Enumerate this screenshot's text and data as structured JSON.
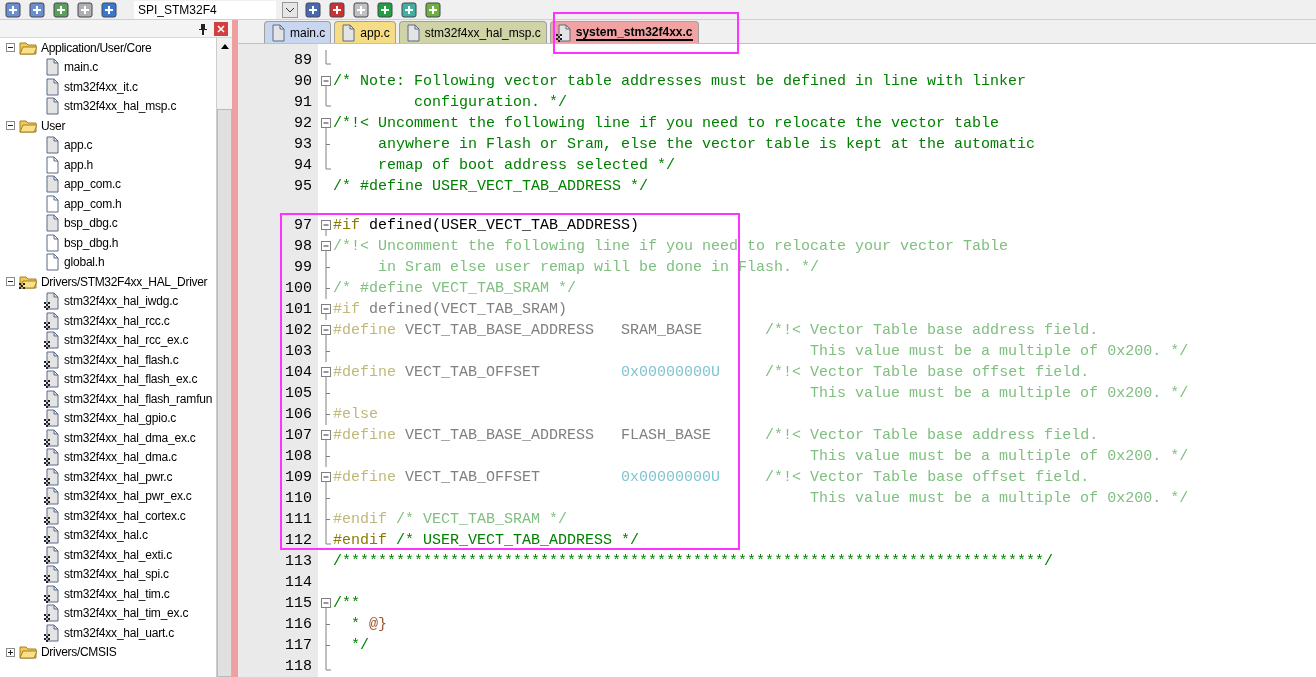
{
  "toolbar": {
    "target": "SPI_STM32F4"
  },
  "project": {
    "items": [
      {
        "label": "Application/User/Core",
        "kind": "folder",
        "expanded": true,
        "children": [
          {
            "label": "main.c",
            "kind": "source"
          },
          {
            "label": "stm32f4xx_it.c",
            "kind": "source"
          },
          {
            "label": "stm32f4xx_hal_msp.c",
            "kind": "source"
          }
        ]
      },
      {
        "label": "User",
        "kind": "folder",
        "expanded": true,
        "children": [
          {
            "label": "app.c",
            "kind": "source"
          },
          {
            "label": "app.h",
            "kind": "header"
          },
          {
            "label": "app_com.c",
            "kind": "source"
          },
          {
            "label": "app_com.h",
            "kind": "header"
          },
          {
            "label": "bsp_dbg.c",
            "kind": "source"
          },
          {
            "label": "bsp_dbg.h",
            "kind": "header"
          },
          {
            "label": "global.h",
            "kind": "header"
          }
        ]
      },
      {
        "label": "Drivers/STM32F4xx_HAL_Driver",
        "kind": "library",
        "expanded": true,
        "children": [
          {
            "label": "stm32f4xx_hal_iwdg.c",
            "kind": "library"
          },
          {
            "label": "stm32f4xx_hal_rcc.c",
            "kind": "library"
          },
          {
            "label": "stm32f4xx_hal_rcc_ex.c",
            "kind": "library"
          },
          {
            "label": "stm32f4xx_hal_flash.c",
            "kind": "library"
          },
          {
            "label": "stm32f4xx_hal_flash_ex.c",
            "kind": "library"
          },
          {
            "label": "stm32f4xx_hal_flash_ramfun",
            "kind": "library"
          },
          {
            "label": "stm32f4xx_hal_gpio.c",
            "kind": "library"
          },
          {
            "label": "stm32f4xx_hal_dma_ex.c",
            "kind": "library"
          },
          {
            "label": "stm32f4xx_hal_dma.c",
            "kind": "library"
          },
          {
            "label": "stm32f4xx_hal_pwr.c",
            "kind": "library"
          },
          {
            "label": "stm32f4xx_hal_pwr_ex.c",
            "kind": "library"
          },
          {
            "label": "stm32f4xx_hal_cortex.c",
            "kind": "library"
          },
          {
            "label": "stm32f4xx_hal.c",
            "kind": "library"
          },
          {
            "label": "stm32f4xx_hal_exti.c",
            "kind": "library"
          },
          {
            "label": "stm32f4xx_hal_spi.c",
            "kind": "library"
          },
          {
            "label": "stm32f4xx_hal_tim.c",
            "kind": "library"
          },
          {
            "label": "stm32f4xx_hal_tim_ex.c",
            "kind": "library"
          },
          {
            "label": "stm32f4xx_hal_uart.c",
            "kind": "library"
          }
        ]
      },
      {
        "label": "Drivers/CMSIS",
        "kind": "folder",
        "expanded": false
      }
    ]
  },
  "tabs": [
    {
      "label": "main.c",
      "kind": "source",
      "color": "#c9d6ef",
      "selected": false
    },
    {
      "label": "app.c",
      "kind": "source",
      "color": "#f6dd85",
      "selected": false
    },
    {
      "label": "stm32f4xx_hal_msp.c",
      "kind": "source",
      "color": "#cfd3a6",
      "selected": false
    },
    {
      "label": "system_stm32f4xx.c",
      "kind": "library",
      "color": "#f1a3a3",
      "selected": true
    }
  ],
  "editor": {
    "lines": [
      {
        "number": "89",
        "kind": "fold_close"
      },
      {
        "number": "90",
        "kind": "fold_open",
        "tokens": [
          {
            "kind": "comment",
            "text": "/* Note: Following vector table addresses must be defined in line with linker"
          }
        ]
      },
      {
        "number": "91",
        "kind": "fold_close",
        "tokens": [
          {
            "kind": "comment",
            "text": "         configuration. */"
          }
        ]
      },
      {
        "number": "92",
        "kind": "fold_open",
        "tokens": [
          {
            "kind": "comment",
            "text": "/*!< Uncomment the following line if you need to relocate the vector table"
          }
        ]
      },
      {
        "number": "93",
        "kind": "fold_inner",
        "tokens": [
          {
            "kind": "comment",
            "text": "     anywhere in Flash or Sram, else the vector table is kept at the automatic"
          }
        ]
      },
      {
        "number": "94",
        "kind": "fold_close",
        "tokens": [
          {
            "kind": "comment",
            "text": "     remap of boot address selected */"
          }
        ]
      },
      {
        "number": "95",
        "kind": "plain",
        "tokens": [
          {
            "kind": "comment",
            "text": "/* #define USER_VECT_TAB_ADDRESS */"
          }
        ]
      },
      {
        "kind": "plain"
      },
      {
        "number": "97",
        "kind": "fold_open",
        "tokens": [
          {
            "kind": "directive",
            "text": "#if"
          },
          {
            "kind": "plain",
            "text": " defined(USER_VECT_TAB_ADDRESS)"
          }
        ]
      },
      {
        "number": "98",
        "kind": "fold_open",
        "tokens": [
          {
            "kind": "comment_dim",
            "text": "/*!< Uncomment the following line if you need to relocate your vector Table"
          }
        ]
      },
      {
        "number": "99",
        "kind": "fold_inner",
        "tokens": [
          {
            "kind": "comment_dim",
            "text": "     in Sram else user remap will be done in Flash. */"
          }
        ]
      },
      {
        "number": "100",
        "kind": "fold_inner",
        "tokens": [
          {
            "kind": "comment_dim",
            "text": "/* #define VECT_TAB_SRAM */"
          }
        ]
      },
      {
        "number": "101",
        "kind": "fold_open",
        "tokens": [
          {
            "kind": "directive_dim",
            "text": "#if"
          },
          {
            "kind": "plain_dim",
            "text": " defined(VECT_TAB_SRAM)"
          }
        ]
      },
      {
        "number": "102",
        "kind": "fold_open",
        "tokens": [
          {
            "kind": "directive_dim",
            "text": "#define"
          },
          {
            "kind": "plain_dim",
            "text": " VECT_TAB_BASE_ADDRESS   SRAM_BASE       "
          },
          {
            "kind": "comment_dim",
            "text": "/*!< Vector Table base address field."
          }
        ]
      },
      {
        "number": "103",
        "kind": "fold_inner",
        "tokens": [
          {
            "kind": "comment_dim",
            "text": "                                                     This value must be a multiple of 0x200. */"
          }
        ]
      },
      {
        "number": "104",
        "kind": "fold_open",
        "tokens": [
          {
            "kind": "directive_dim",
            "text": "#define"
          },
          {
            "kind": "plain_dim",
            "text": " VECT_TAB_OFFSET         "
          },
          {
            "kind": "number_dim",
            "text": "0x00000000U"
          },
          {
            "kind": "comment_dim",
            "text": "     /*!< Vector Table base offset field."
          }
        ]
      },
      {
        "number": "105",
        "kind": "fold_inner",
        "tokens": [
          {
            "kind": "comment_dim",
            "text": "                                                     This value must be a multiple of 0x200. */"
          }
        ]
      },
      {
        "number": "106",
        "kind": "fold_inner",
        "tokens": [
          {
            "kind": "directive_dim",
            "text": "#else"
          }
        ]
      },
      {
        "number": "107",
        "kind": "fold_open",
        "tokens": [
          {
            "kind": "directive_dim",
            "text": "#define"
          },
          {
            "kind": "plain_dim",
            "text": " VECT_TAB_BASE_ADDRESS   FLASH_BASE      "
          },
          {
            "kind": "comment_dim",
            "text": "/*!< Vector Table base address field."
          }
        ]
      },
      {
        "number": "108",
        "kind": "fold_inner",
        "tokens": [
          {
            "kind": "comment_dim",
            "text": "                                                     This value must be a multiple of 0x200. */"
          }
        ]
      },
      {
        "number": "109",
        "kind": "fold_open",
        "tokens": [
          {
            "kind": "directive_dim",
            "text": "#define"
          },
          {
            "kind": "plain_dim",
            "text": " VECT_TAB_OFFSET         "
          },
          {
            "kind": "number_dim",
            "text": "0x00000000U"
          },
          {
            "kind": "comment_dim",
            "text": "     /*!< Vector Table base offset field."
          }
        ]
      },
      {
        "number": "110",
        "kind": "fold_inner",
        "tokens": [
          {
            "kind": "comment_dim",
            "text": "                                                     This value must be a multiple of 0x200. */"
          }
        ]
      },
      {
        "number": "111",
        "kind": "fold_inner",
        "tokens": [
          {
            "kind": "directive_dim",
            "text": "#endif"
          },
          {
            "kind": "comment_dim",
            "text": " /* VECT_TAB_SRAM */"
          }
        ]
      },
      {
        "number": "112",
        "kind": "fold_close",
        "tokens": [
          {
            "kind": "directive",
            "text": "#endif"
          },
          {
            "kind": "comment",
            "text": " /* USER_VECT_TAB_ADDRESS */"
          }
        ]
      },
      {
        "number": "113",
        "kind": "plain",
        "tokens": [
          {
            "kind": "comment",
            "text": "/******************************************************************************/"
          }
        ]
      },
      {
        "number": "114",
        "kind": "plain"
      },
      {
        "number": "115",
        "kind": "fold_open",
        "tokens": [
          {
            "kind": "comment",
            "text": "/**"
          }
        ]
      },
      {
        "number": "116",
        "kind": "fold_inner",
        "tokens": [
          {
            "kind": "comment",
            "text": "  * "
          },
          {
            "kind": "doc_tag",
            "text": "@}"
          }
        ]
      },
      {
        "number": "117",
        "kind": "fold_inner",
        "tokens": [
          {
            "kind": "comment",
            "text": "  */"
          }
        ]
      },
      {
        "number": "118",
        "kind": "fold_close"
      }
    ]
  }
}
